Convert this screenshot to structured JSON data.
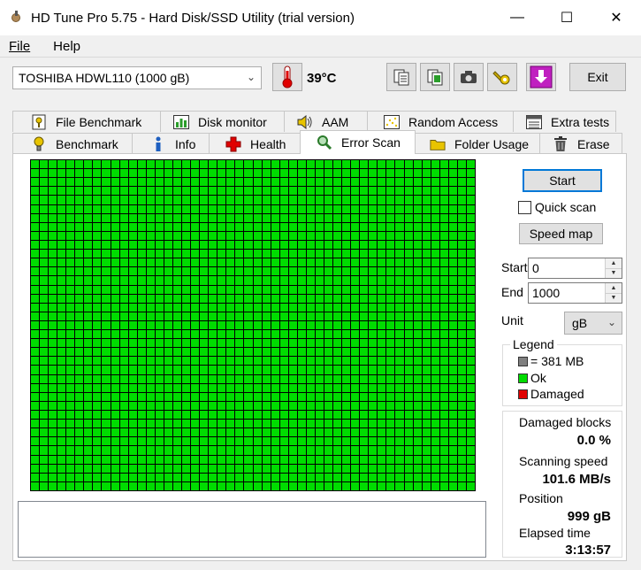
{
  "window": {
    "title": "HD Tune Pro 5.75 - Hard Disk/SSD Utility (trial version)",
    "minimize_glyph": "—",
    "maximize_glyph": "☐",
    "close_glyph": "✕"
  },
  "menu": {
    "file": "File",
    "help": "Help"
  },
  "toolbar": {
    "drive": "TOSHIBA HDWL110 (1000 gB)",
    "temperature": "39°C",
    "exit_label": "Exit",
    "icons": [
      "thermometer-icon",
      "copy-info-icon",
      "copy-screen-icon",
      "screenshot-icon",
      "options-icon",
      "save-icon"
    ]
  },
  "tabs": {
    "top": [
      {
        "label": "File Benchmark",
        "icon": "file-benchmark-icon"
      },
      {
        "label": "Disk monitor",
        "icon": "disk-monitor-icon"
      },
      {
        "label": "AAM",
        "icon": "speaker-icon"
      },
      {
        "label": "Random Access",
        "icon": "random-access-icon"
      },
      {
        "label": "Extra tests",
        "icon": "extra-tests-icon"
      }
    ],
    "bottom": [
      {
        "label": "Benchmark",
        "icon": "benchmark-icon"
      },
      {
        "label": "Info",
        "icon": "info-icon"
      },
      {
        "label": "Health",
        "icon": "health-icon"
      },
      {
        "label": "Error Scan",
        "icon": "magnifier-icon"
      },
      {
        "label": "Folder Usage",
        "icon": "folder-icon"
      },
      {
        "label": "Erase",
        "icon": "trash-icon"
      }
    ]
  },
  "scan": {
    "start_label": "Start",
    "quick_scan_label": "Quick scan",
    "quick_scan_checked": false,
    "speed_map_label": "Speed map",
    "start_field_label": "Start",
    "start_value": "0",
    "end_field_label": "End",
    "end_value": "1000",
    "unit_label": "Unit",
    "unit_value": "gB",
    "grid_cols": 50,
    "grid_rows": 37,
    "block_status": "ok"
  },
  "legend": {
    "title": "Legend",
    "block_size": "= 381 MB",
    "ok": "Ok",
    "damaged": "Damaged",
    "colors": {
      "block": "#808080",
      "ok": "#00dc00",
      "damaged": "#e00000"
    }
  },
  "stats": {
    "damaged_blocks_label": "Damaged blocks",
    "damaged_blocks_value": "0.0 %",
    "speed_label": "Scanning speed",
    "speed_value": "101.6 MB/s",
    "position_label": "Position",
    "position_value": "999 gB",
    "elapsed_label": "Elapsed time",
    "elapsed_value": "3:13:57"
  }
}
